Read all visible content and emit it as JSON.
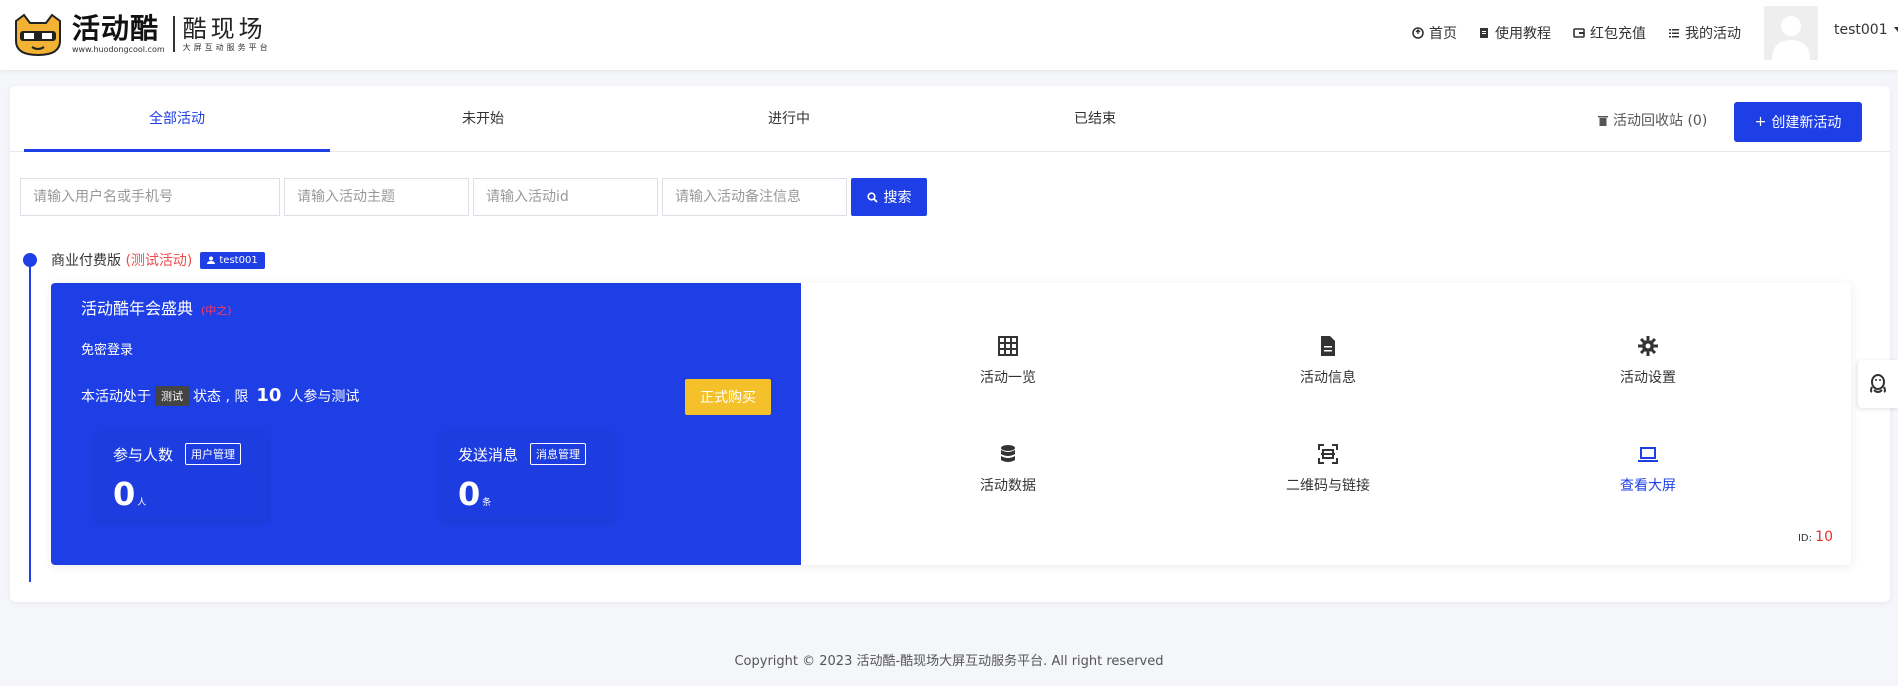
{
  "brand": {
    "name": "活动酷",
    "url": "www.huodongcool.com",
    "product": "酷现场",
    "tagline": "大屏互动服务平台"
  },
  "topnav": {
    "items": [
      {
        "label": "首页",
        "icon": "home-icon"
      },
      {
        "label": "使用教程",
        "icon": "doc-icon"
      },
      {
        "label": "红包充值",
        "icon": "wallet-icon"
      },
      {
        "label": "我的活动",
        "icon": "list-icon"
      }
    ],
    "username": "test001"
  },
  "tabs": [
    {
      "label": "全部活动",
      "active": true
    },
    {
      "label": "未开始",
      "active": false
    },
    {
      "label": "进行中",
      "active": false
    },
    {
      "label": "已结束",
      "active": false
    }
  ],
  "recycle_label": "活动回收站 (0)",
  "create_label": "创建新活动",
  "filters": {
    "user_placeholder": "请输入用户名或手机号",
    "theme_placeholder": "请输入活动主题",
    "id_placeholder": "请输入活动id",
    "note_placeholder": "请输入活动备注信息",
    "search_label": "搜索"
  },
  "timeline": {
    "plan": "商业付费版",
    "plan_tag": "(测试活动)",
    "user": "test001"
  },
  "activity": {
    "title": "活动酷年会盛典",
    "status": "(中之)",
    "login": "免密登录",
    "state_prefix": "本活动处于",
    "state_badge": "测试",
    "state_mid": "状态 , 限",
    "limit": "10",
    "state_suffix": "人参与测试",
    "buy_label": "正式购买",
    "participants": {
      "label": "参与人数",
      "mgr": "用户管理",
      "value": "0",
      "unit": "人"
    },
    "messages": {
      "label": "发送消息",
      "mgr": "消息管理",
      "value": "0",
      "unit": "条"
    },
    "actions": [
      {
        "label": "活动一览",
        "icon": "grid-icon"
      },
      {
        "label": "活动信息",
        "icon": "file-icon"
      },
      {
        "label": "活动设置",
        "icon": "gear-icon"
      },
      {
        "label": "活动数据",
        "icon": "database-icon"
      },
      {
        "label": "二维码与链接",
        "icon": "qrcode-scan-icon"
      },
      {
        "label": "查看大屏",
        "icon": "laptop-icon"
      }
    ],
    "id_label": "ID:",
    "id_value": "10"
  },
  "footer": "Copyright © 2023 活动酷-酷现场大屏互动服务平台. All right reserved",
  "colors": {
    "primary": "#1f3fe6",
    "buy": "#f5c12b",
    "danger": "#e53030"
  }
}
